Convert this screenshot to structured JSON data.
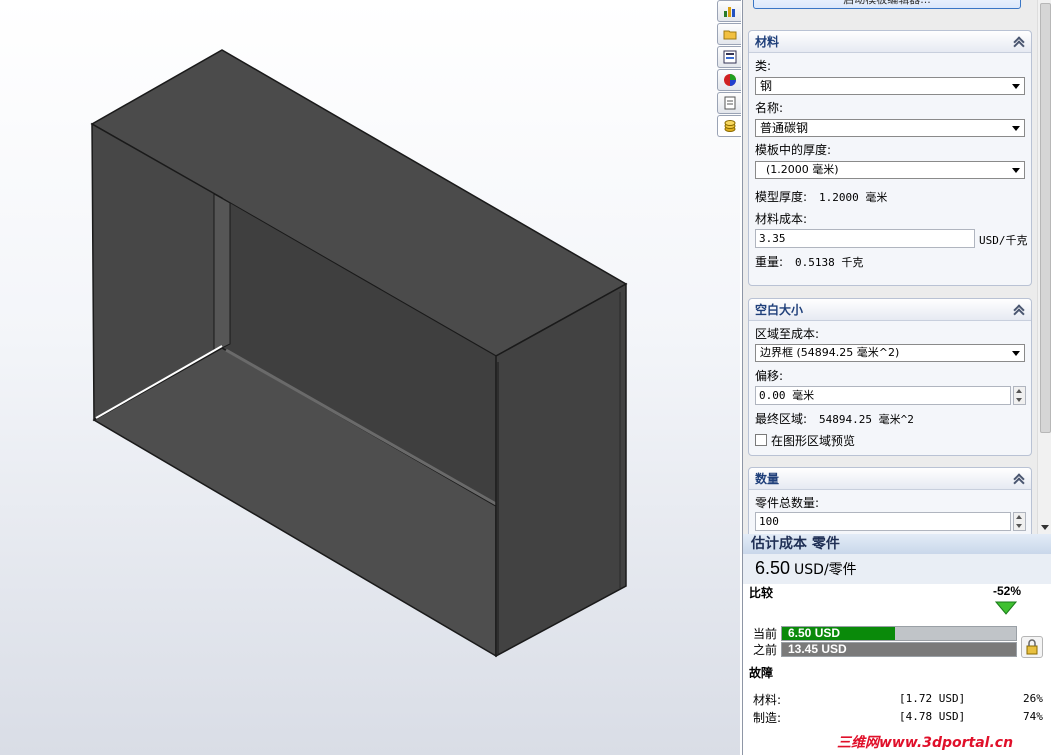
{
  "top_button": {
    "label": "启动模板编辑器..."
  },
  "material": {
    "title": "材料",
    "class_label": "类:",
    "class_value": "钢",
    "name_label": "名称:",
    "name_value": "普通碳钢",
    "thickness_label": "模板中的厚度:",
    "thickness_value": "(1.2000 毫米)",
    "model_thickness_label": "模型厚度:",
    "model_thickness_value": "1.2000 毫米",
    "cost_label": "材料成本:",
    "cost_value": "3.35",
    "cost_unit": "USD/千克",
    "weight_label": "重量:",
    "weight_value": "0.5138 千克"
  },
  "blank_size": {
    "title": "空白大小",
    "area_label": "区域至成本:",
    "area_value": "边界框 (54894.25 毫米^2)",
    "offset_label": "偏移:",
    "offset_value": "0.00 毫米",
    "final_area_label": "最终区域:",
    "final_area_value": "54894.25 毫米^2",
    "preview_label": "在图形区域预览"
  },
  "quantity": {
    "title": "数量",
    "total_label": "零件总数量:",
    "total_value": "100"
  },
  "estimate": {
    "title": "估计成本 零件",
    "price": "6.50",
    "price_unit": "USD/零件",
    "compare_title": "比较",
    "change_pct": "-52%",
    "current_label": "当前",
    "current_value": "6.50 USD",
    "current_fraction": 0.483,
    "previous_label": "之前",
    "previous_value": "13.45 USD",
    "previous_fraction": 1.0,
    "breakdown_title": "故障",
    "rows": [
      {
        "label": "材料:",
        "value": "[1.72 USD]",
        "pct": "26%"
      },
      {
        "label": "制造:",
        "value": "[4.78 USD]",
        "pct": "74%"
      }
    ]
  },
  "colors": {
    "current_bar": "#0a8a0a",
    "previous_bar": "#7a7a7a",
    "accent": "#1f3f7a",
    "watermark": "#e0102a"
  },
  "watermark": {
    "text": "三维网www.3dportal.cn"
  }
}
